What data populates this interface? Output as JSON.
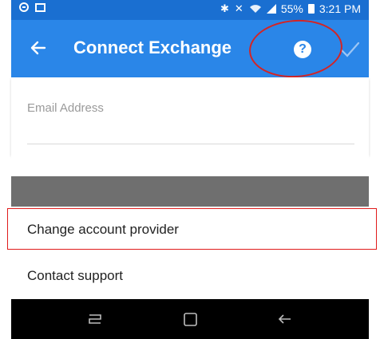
{
  "status_bar": {
    "battery": "55%",
    "time": "3:21 PM",
    "left_icons": [
      "circle-minus-icon",
      "image-icon"
    ],
    "right_icons": [
      "bluetooth-icon",
      "mute-icon",
      "wifi-icon",
      "signal-icon",
      "battery-icon"
    ]
  },
  "app_bar": {
    "title": "Connect Exchange",
    "help_symbol": "?",
    "back_icon": "back-arrow-icon",
    "confirm_icon": "checkmark-icon"
  },
  "form": {
    "email": {
      "placeholder": "Email Address",
      "value": ""
    }
  },
  "menu": {
    "items": [
      {
        "label": "Change account provider"
      },
      {
        "label": "Contact support"
      }
    ]
  },
  "colors": {
    "status_bar": "#1a6fd1",
    "app_bar": "#2a86e8",
    "annotation": "#d42424",
    "nav_bar": "#000000"
  }
}
